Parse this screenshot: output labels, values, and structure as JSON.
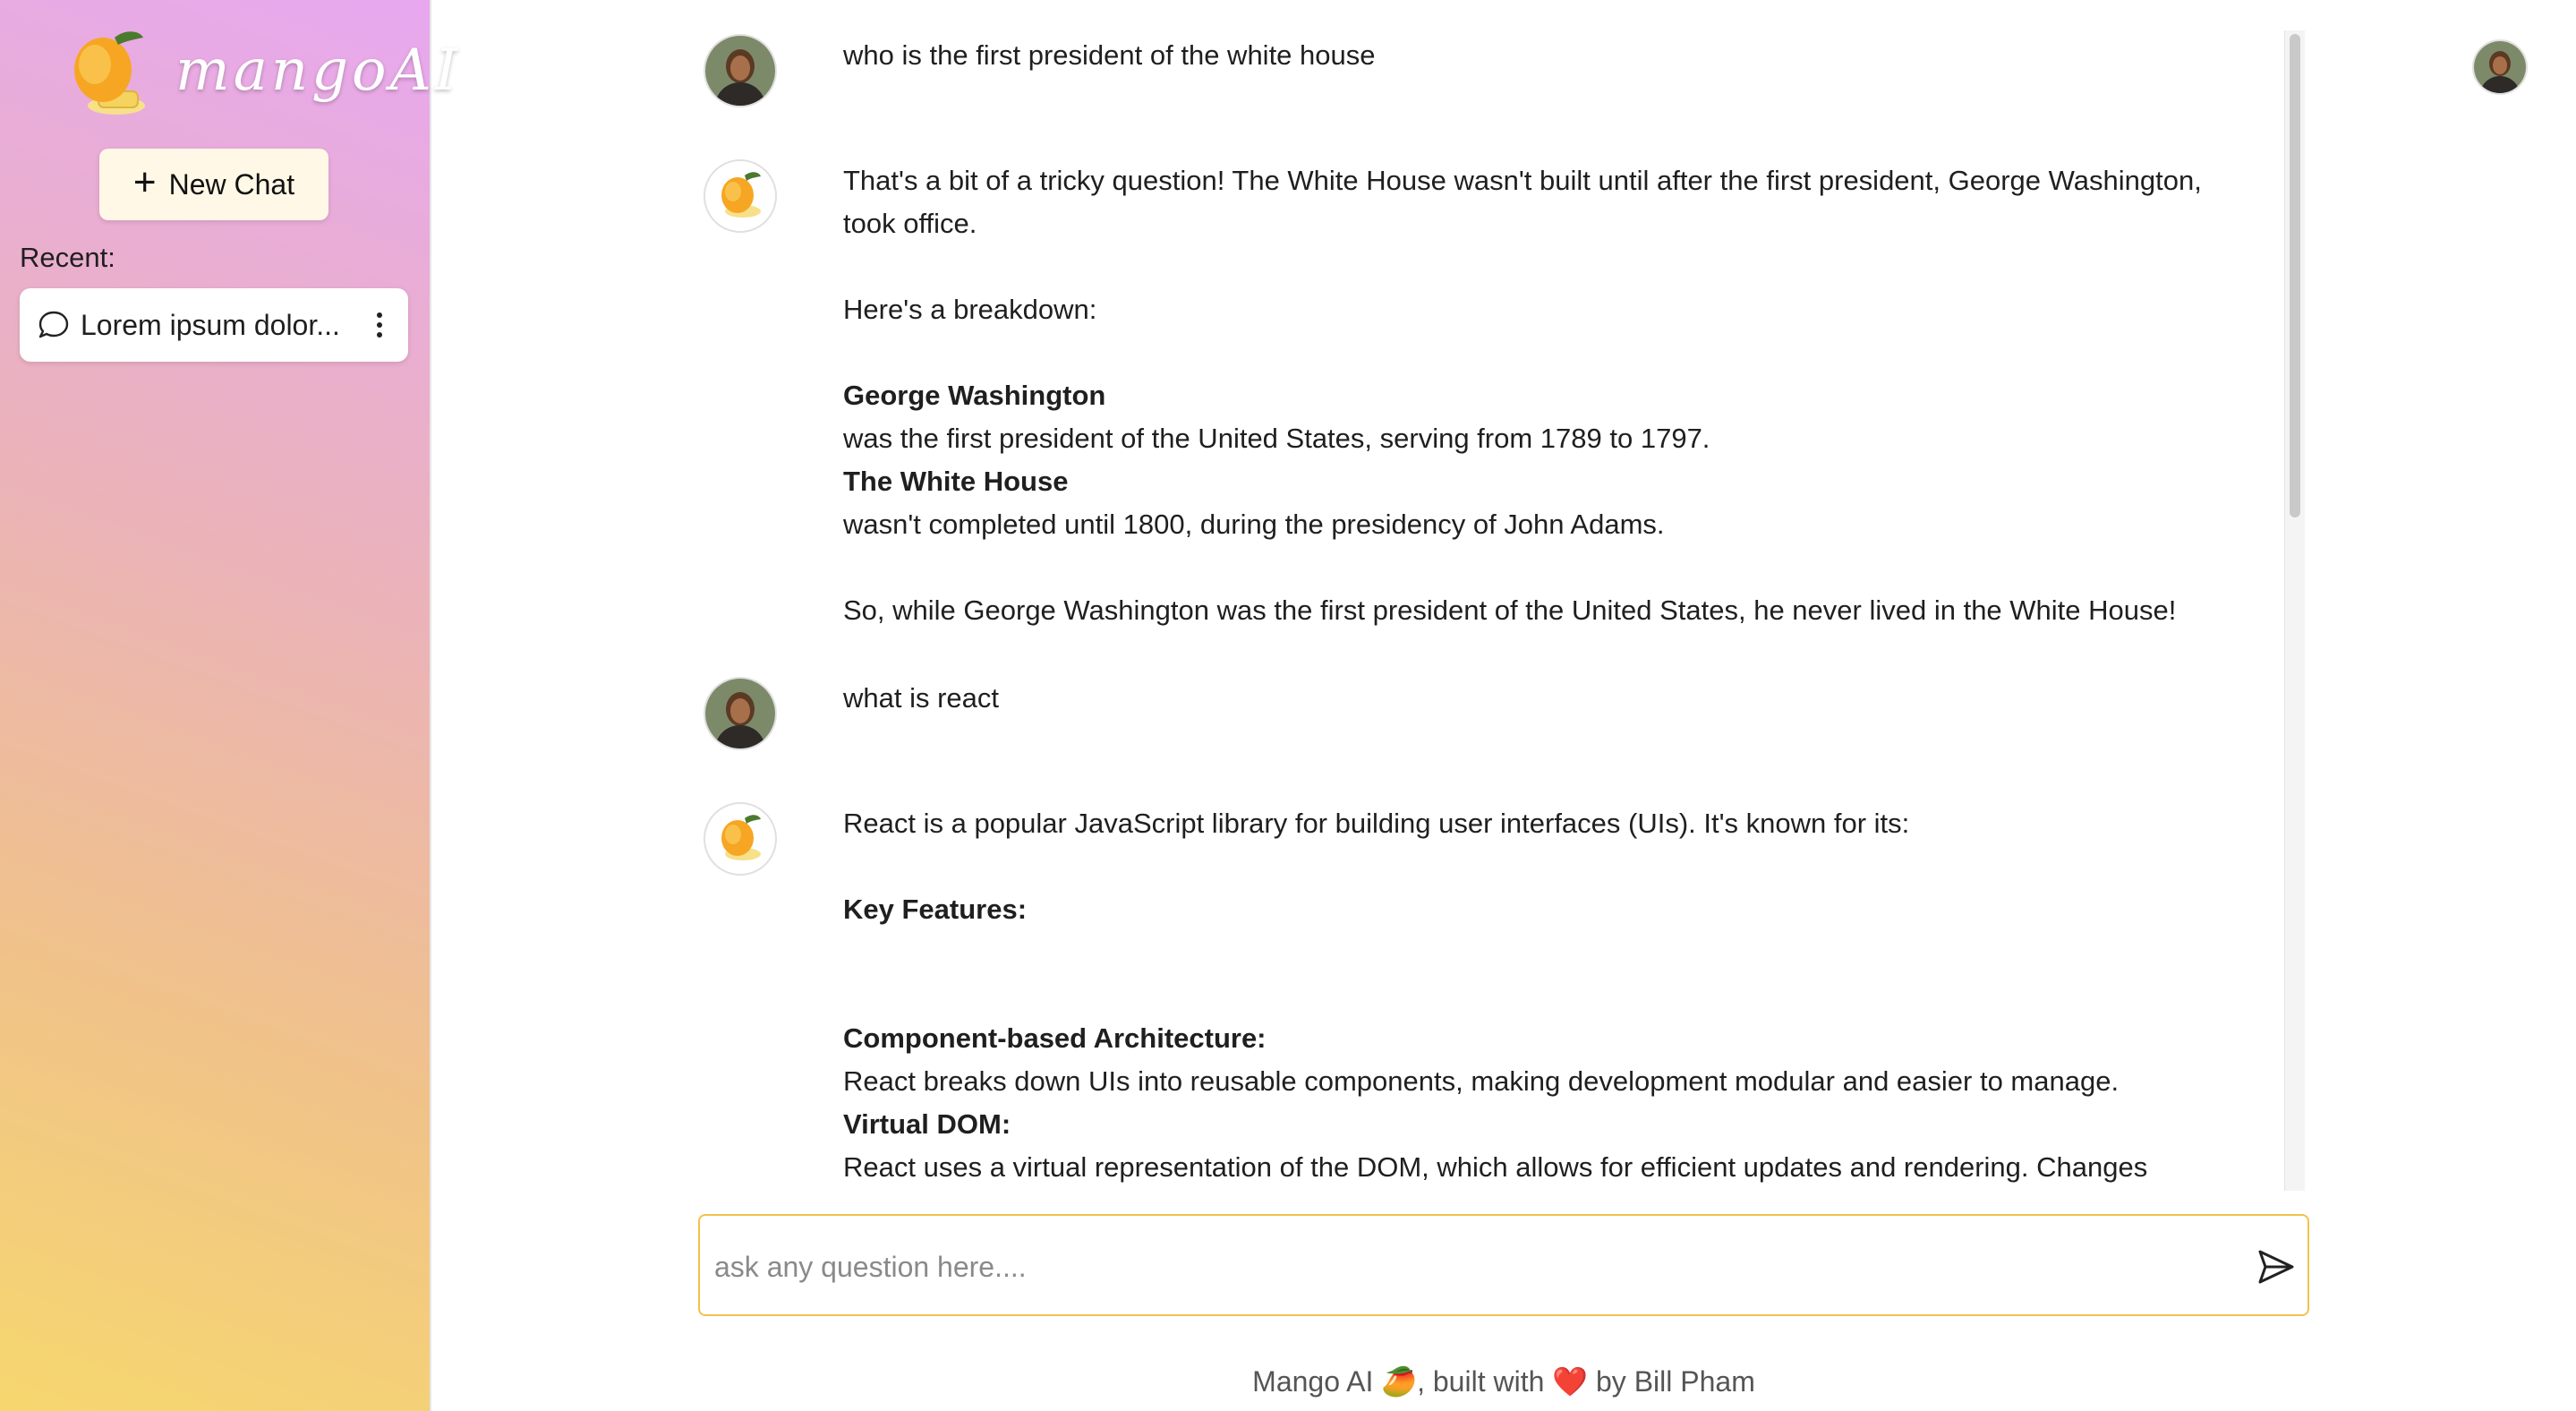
{
  "app": {
    "logo_text": "mangoAI"
  },
  "sidebar": {
    "new_chat_label": "New Chat",
    "recent_label": "Recent:",
    "recent_items": [
      {
        "label": "Lorem ipsum dolor..."
      }
    ]
  },
  "chat": {
    "messages": [
      {
        "role": "user",
        "lines": [
          "who is the first president of the white house"
        ]
      },
      {
        "role": "assistant",
        "p1": "That's a bit of a tricky question! The White House wasn't built until after the first president, George Washington, took office.",
        "p2": "Here's a breakdown:",
        "b1": "George Washington",
        "t1": "was the first president of the United States, serving from 1789 to 1797.",
        "b2": "The White House",
        "t2": "wasn't completed until 1800, during the presidency of John Adams.",
        "p3": "So, while George Washington was the first president of the United States, he never lived in the White House!"
      },
      {
        "role": "user",
        "lines": [
          "what is react"
        ]
      },
      {
        "role": "assistant",
        "p1": "React is a popular JavaScript library for building user interfaces (UIs). It's known for its:",
        "h1": "Key Features:",
        "b1": "Component-based Architecture:",
        "t1": "React breaks down UIs into reusable components, making development modular and easier to manage.",
        "b2": "Virtual DOM:",
        "t2": "React uses a virtual representation of the DOM, which allows for efficient updates and rendering. Changes"
      }
    ]
  },
  "input": {
    "placeholder": "ask any question here...."
  },
  "footer": {
    "text": "Mango AI 🥭, built with ❤️ by Bill Pham"
  },
  "colors": {
    "accent": "#f2c14e",
    "sidebar_top": "#e7a8f0",
    "sidebar_bottom": "#f6d76e"
  },
  "icons": [
    "mango-logo-icon",
    "plus-icon",
    "chat-bubble-icon",
    "more-vertical-icon",
    "user-avatar",
    "mango-avatar",
    "send-icon"
  ]
}
